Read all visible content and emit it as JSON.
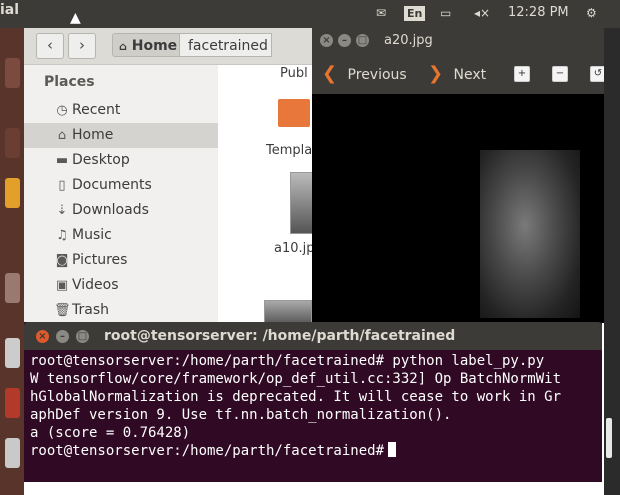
{
  "top_panel": {
    "app_title": "ial",
    "indicators": [
      "envelope",
      "En",
      "battery",
      "volume"
    ],
    "language": "En",
    "clock": "12:28 PM"
  },
  "file_manager": {
    "back_icon": "‹",
    "forward_icon": "›",
    "breadcrumb": [
      "Home",
      "facetrained"
    ],
    "places_heading": "Places",
    "places": [
      {
        "label": "Recent",
        "icon": "clock-icon"
      },
      {
        "label": "Home",
        "icon": "home-icon"
      },
      {
        "label": "Desktop",
        "icon": "folder-icon"
      },
      {
        "label": "Documents",
        "icon": "document-icon"
      },
      {
        "label": "Downloads",
        "icon": "download-icon"
      },
      {
        "label": "Music",
        "icon": "music-icon"
      },
      {
        "label": "Pictures",
        "icon": "camera-icon"
      },
      {
        "label": "Videos",
        "icon": "video-icon"
      },
      {
        "label": "Trash",
        "icon": "trash-icon"
      }
    ],
    "files": [
      "Publ",
      "Templa",
      "a10.jp"
    ]
  },
  "image_viewer": {
    "title": "a20.jpg",
    "previous_label": "Previous",
    "next_label": "Next"
  },
  "terminal": {
    "title": "root@tensorserver: /home/parth/facetrained",
    "lines": [
      "root@tensorserver:/home/parth/facetrained# python label_py.py",
      "W tensorflow/core/framework/op_def_util.cc:332] Op BatchNormWit",
      "hGlobalNormalization is deprecated. It will cease to work in Gr",
      "aphDef version 9. Use tf.nn.batch_normalization().",
      "a (score = 0.76428)"
    ],
    "prompt": "root@tensorserver:/home/parth/facetrained#"
  },
  "colors": {
    "terminal_bg": "#300a24",
    "panel_bg": "#3c3b37",
    "accent_orange": "#e6752f"
  }
}
